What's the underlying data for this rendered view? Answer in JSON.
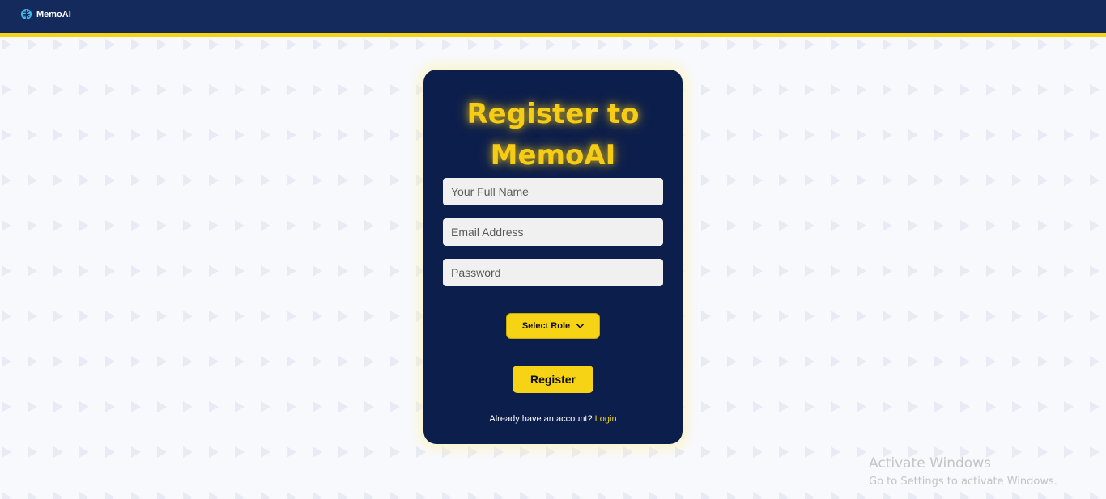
{
  "app": {
    "brand_name": "MemoAI",
    "brand_icon": "brain-icon"
  },
  "colors": {
    "navbar": "#142a5c",
    "accent_yellow": "#f7d316",
    "card_bg": "#0c1e4c",
    "title": "#f7cc14",
    "page_bg": "#f8f9fd"
  },
  "register_form": {
    "title": "Register to MemoAI",
    "full_name": {
      "placeholder": "Your Full Name",
      "value": ""
    },
    "email": {
      "placeholder": "Email Address",
      "value": ""
    },
    "password": {
      "placeholder": "Password",
      "value": ""
    },
    "role_select": {
      "selected": "Select Role"
    },
    "register_label": "Register",
    "login_prompt": "Already have an account?",
    "login_link": "Login"
  },
  "windows_watermark": {
    "title": "Activate Windows",
    "subtitle": "Go to Settings to activate Windows."
  }
}
